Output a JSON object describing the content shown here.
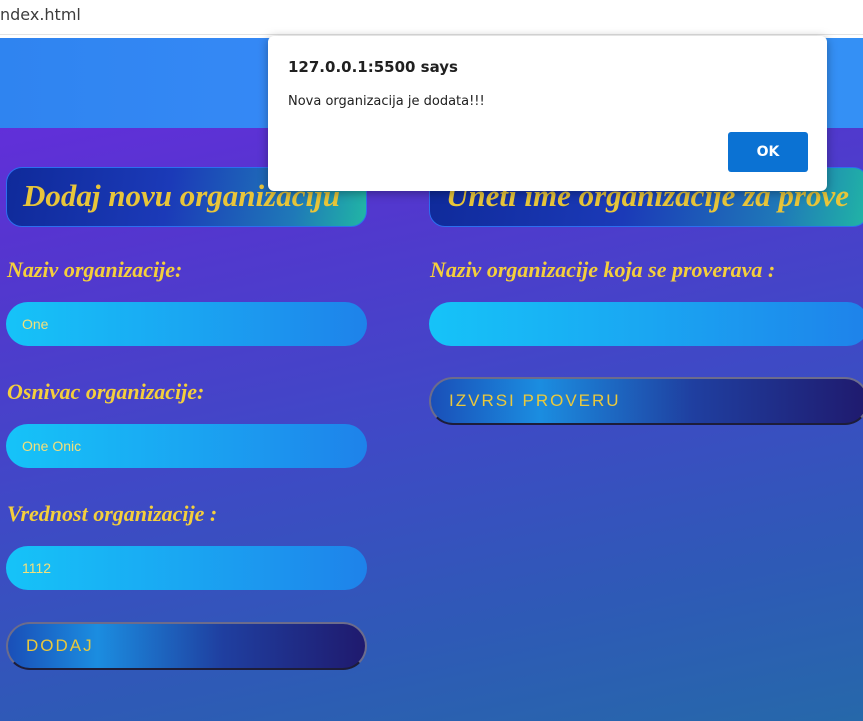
{
  "browser": {
    "address_text": "ndex.html"
  },
  "left_form": {
    "title": "Dodaj novu organizaciju",
    "name_label": "Naziv organizacije:",
    "name_value": "One",
    "founder_label": "Osnivac organizacije:",
    "founder_value": "One Onic",
    "value_label": "Vrednost organizacije :",
    "value_value": "1112",
    "submit_label": "DODAJ"
  },
  "right_form": {
    "title": "Uneti ime organizacije za prove",
    "name_label": "Naziv organizacije koja se proverava :",
    "name_value": "",
    "submit_label": "IZVRSI PROVERU"
  },
  "alert": {
    "title": "127.0.0.1:5500 says",
    "message": "Nova organizacija je dodata!!!",
    "ok_label": "OK"
  },
  "colors": {
    "accent_text": "#f4cf3c",
    "header_blue": "#3a8dfa",
    "alert_button": "#0b72d3"
  }
}
